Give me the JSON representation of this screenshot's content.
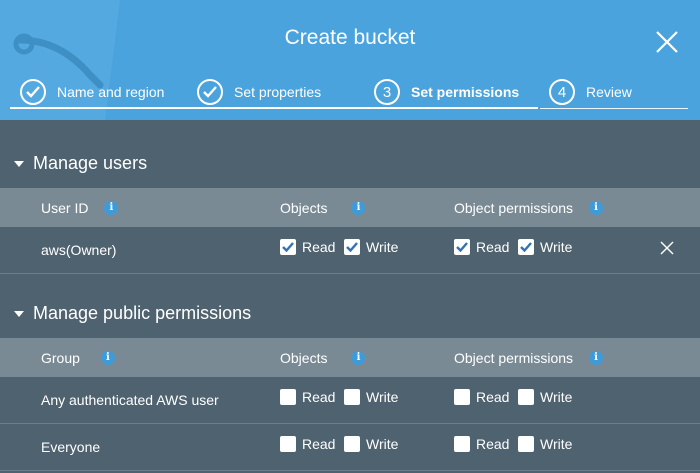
{
  "header": {
    "title": "Create bucket",
    "steps": [
      {
        "number": "1",
        "label": "Name and region",
        "status": "done"
      },
      {
        "number": "2",
        "label": "Set properties",
        "status": "done"
      },
      {
        "number": "3",
        "label": "Set permissions",
        "status": "active"
      },
      {
        "number": "4",
        "label": "Review",
        "status": "pending"
      }
    ]
  },
  "manage_users": {
    "title": "Manage users",
    "columns": {
      "user_id": "User ID",
      "objects": "Objects",
      "object_permissions": "Object permissions"
    },
    "rows": [
      {
        "user": "aws(Owner)",
        "objects_read": true,
        "objects_write": true,
        "perm_read": true,
        "perm_write": true
      }
    ]
  },
  "public_permissions": {
    "title": "Manage public permissions",
    "columns": {
      "group": "Group",
      "objects": "Objects",
      "object_permissions": "Object permissions"
    },
    "rows": [
      {
        "group": "Any authenticated AWS user",
        "objects_read": false,
        "objects_write": false,
        "perm_read": false,
        "perm_write": false
      },
      {
        "group": "Everyone",
        "objects_read": false,
        "objects_write": false,
        "perm_read": false,
        "perm_write": false
      }
    ]
  },
  "labels": {
    "read": "Read",
    "write": "Write",
    "info": "i"
  },
  "colors": {
    "header_bg": "#4aa3dc",
    "body_bg": "#4f6270",
    "table_header_bg": "#7a8a95",
    "check": "#2e73b8",
    "info": "#3f9bd8"
  },
  "icons": {
    "close": "close-icon",
    "check": "checkmark-icon",
    "info": "info-icon",
    "caret": "caret-down-icon",
    "remove": "x-icon"
  }
}
